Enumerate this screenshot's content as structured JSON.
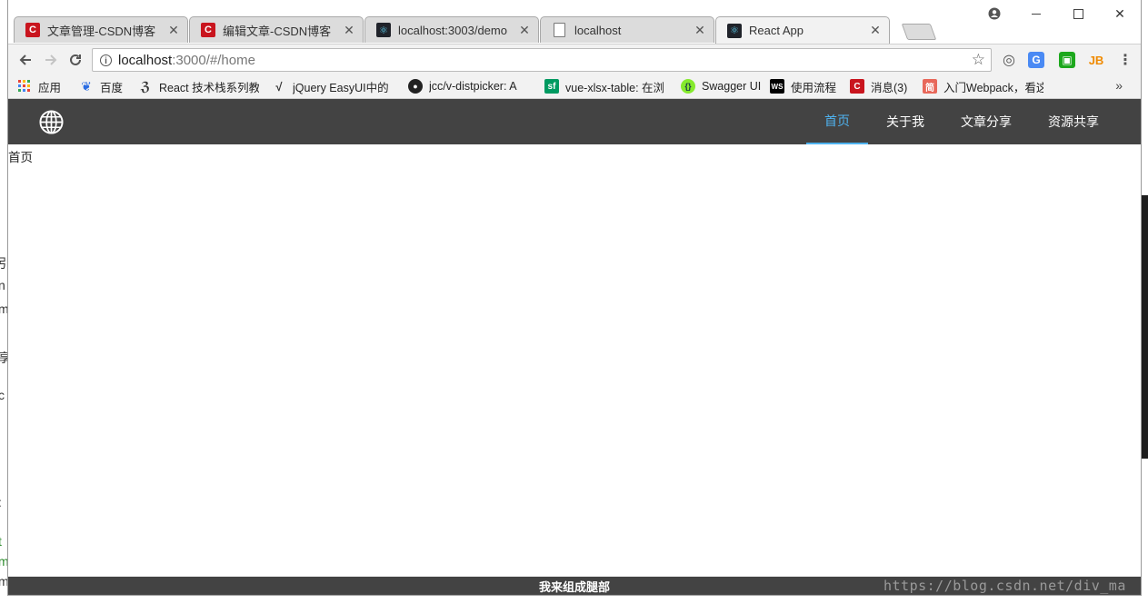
{
  "browser": {
    "tabs": [
      {
        "title": "文章管理-CSDN博客",
        "icon": "csdn-icon",
        "active": false
      },
      {
        "title": "编辑文章-CSDN博客",
        "icon": "csdn-icon",
        "active": false
      },
      {
        "title": "localhost:3003/demo",
        "icon": "react-icon",
        "active": false
      },
      {
        "title": "localhost",
        "icon": "page-icon",
        "active": false
      },
      {
        "title": "React App",
        "icon": "react-icon",
        "active": true
      }
    ],
    "address": {
      "host": "localhost",
      "rest": ":3000/#/home"
    },
    "bookmarks": [
      {
        "label": "应用",
        "icon": "apps-grid-icon"
      },
      {
        "label": "百度",
        "icon": "baidu-paw-icon"
      },
      {
        "label": "React 技术栈系列教",
        "icon": "feather-icon"
      },
      {
        "label": "jQuery EasyUI中的",
        "icon": "easyui-icon"
      },
      {
        "label": "jcc/v-distpicker: A",
        "icon": "github-icon"
      },
      {
        "label": "vue-xlsx-table: 在浏",
        "icon": "segmentfault-icon"
      },
      {
        "label": "Swagger UI",
        "icon": "swagger-icon"
      },
      {
        "label": "使用流程",
        "icon": "webstorm-icon"
      },
      {
        "label": "消息(3)",
        "icon": "csdn-icon"
      },
      {
        "label": "入门Webpack，看这",
        "icon": "jianshu-icon"
      }
    ],
    "bookmarks_more": "»"
  },
  "app": {
    "nav": [
      "首页",
      "关于我",
      "文章分享",
      "资源共享"
    ],
    "active_nav": "首页",
    "page_text": "首页",
    "footer": "我来组成腿部",
    "accent_color": "#4fb3f0",
    "header_color": "#434343"
  },
  "background": {
    "left_glyphs": [
      "引",
      "n",
      "m",
      "享",
      "c",
      ":",
      "t",
      "m",
      "m"
    ],
    "watermark": "https://blog.csdn.net/div_ma"
  }
}
